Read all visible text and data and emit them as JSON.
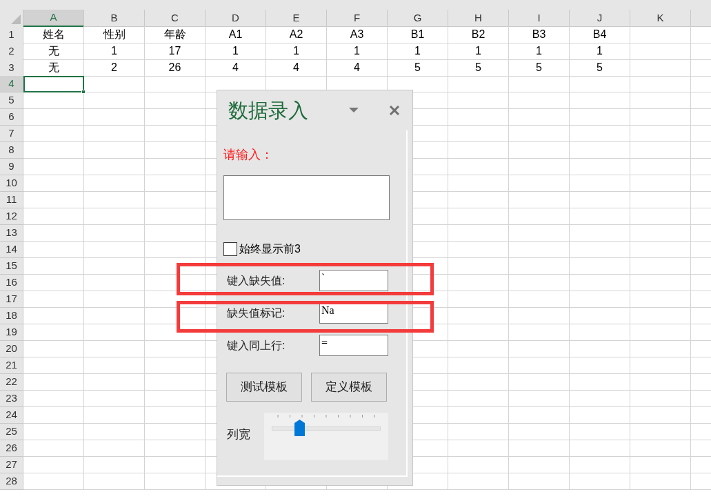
{
  "sheet": {
    "columns": [
      {
        "label": "A",
        "selected": true
      },
      {
        "label": "B",
        "selected": false
      },
      {
        "label": "C",
        "selected": false
      },
      {
        "label": "D",
        "selected": false
      },
      {
        "label": "E",
        "selected": false
      },
      {
        "label": "F",
        "selected": false
      },
      {
        "label": "G",
        "selected": false
      },
      {
        "label": "H",
        "selected": false
      },
      {
        "label": "I",
        "selected": false
      },
      {
        "label": "J",
        "selected": false
      },
      {
        "label": "K",
        "selected": false
      }
    ],
    "rows": [
      {
        "label": "1",
        "selected": false,
        "cells": [
          "姓名",
          "性别",
          "年龄",
          "A1",
          "A2",
          "A3",
          "B1",
          "B2",
          "B3",
          "B4"
        ]
      },
      {
        "label": "2",
        "selected": false,
        "cells": [
          "无",
          "1",
          "17",
          "1",
          "1",
          "1",
          "1",
          "1",
          "1",
          "1"
        ]
      },
      {
        "label": "3",
        "selected": false,
        "cells": [
          "无",
          "2",
          "26",
          "4",
          "4",
          "4",
          "5",
          "5",
          "5",
          "5"
        ]
      },
      {
        "label": "4",
        "selected": true,
        "cells": []
      },
      {
        "label": "5",
        "selected": false,
        "cells": []
      },
      {
        "label": "6",
        "selected": false,
        "cells": []
      },
      {
        "label": "7",
        "selected": false,
        "cells": []
      },
      {
        "label": "8",
        "selected": false,
        "cells": []
      },
      {
        "label": "9",
        "selected": false,
        "cells": []
      },
      {
        "label": "10",
        "selected": false,
        "cells": []
      },
      {
        "label": "11",
        "selected": false,
        "cells": []
      },
      {
        "label": "12",
        "selected": false,
        "cells": []
      },
      {
        "label": "13",
        "selected": false,
        "cells": []
      },
      {
        "label": "14",
        "selected": false,
        "cells": []
      },
      {
        "label": "15",
        "selected": false,
        "cells": []
      },
      {
        "label": "16",
        "selected": false,
        "cells": []
      },
      {
        "label": "17",
        "selected": false,
        "cells": []
      },
      {
        "label": "18",
        "selected": false,
        "cells": []
      },
      {
        "label": "19",
        "selected": false,
        "cells": []
      },
      {
        "label": "20",
        "selected": false,
        "cells": []
      },
      {
        "label": "21",
        "selected": false,
        "cells": []
      },
      {
        "label": "22",
        "selected": false,
        "cells": []
      },
      {
        "label": "23",
        "selected": false,
        "cells": []
      },
      {
        "label": "24",
        "selected": false,
        "cells": []
      },
      {
        "label": "25",
        "selected": false,
        "cells": []
      },
      {
        "label": "26",
        "selected": false,
        "cells": []
      },
      {
        "label": "27",
        "selected": false,
        "cells": []
      },
      {
        "label": "28",
        "selected": false,
        "cells": []
      }
    ]
  },
  "panel": {
    "title": "数据录入",
    "prompt": "请输入：",
    "always_show": {
      "label": "始终显示前3",
      "checked": false
    },
    "fields": [
      {
        "label": "键入缺失值:",
        "value": "`"
      },
      {
        "label": "缺失值标记:",
        "value": "Na"
      },
      {
        "label": "键入同上行:",
        "value": "="
      }
    ],
    "buttons": [
      "测试模板",
      "定义模板"
    ],
    "slider": {
      "label": "列宽",
      "level": 0.25
    }
  }
}
